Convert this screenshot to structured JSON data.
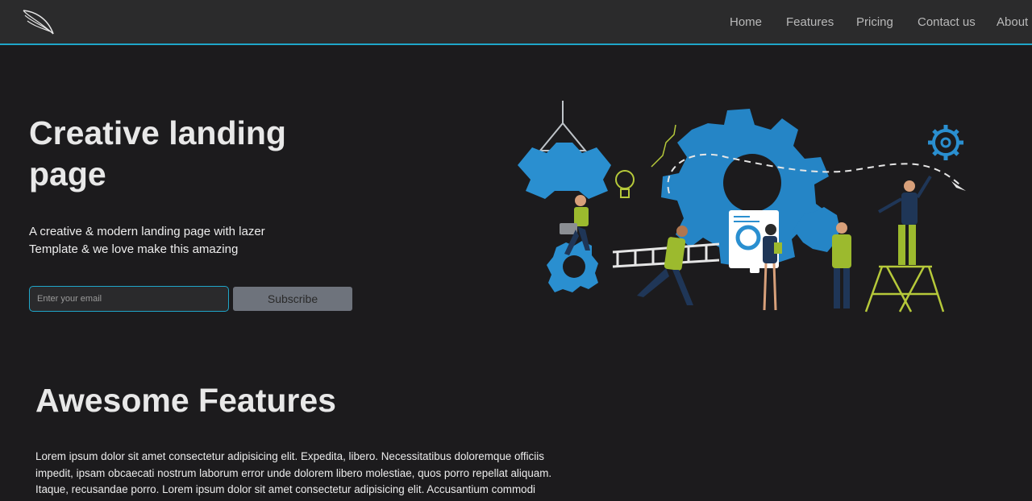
{
  "brand": {
    "logo_icon": "wing-icon"
  },
  "nav": {
    "items": [
      {
        "label": "Home"
      },
      {
        "label": "Features"
      },
      {
        "label": "Pricing"
      },
      {
        "label": "Contact us"
      },
      {
        "label": "About"
      }
    ]
  },
  "hero": {
    "title": "Creative landing page",
    "subtitle": "A creative & modern landing page with lazer Template & we love make this amazing",
    "email_placeholder": "Enter your email",
    "subscribe_label": "Subscribe",
    "illustration": "team-gears-illustration"
  },
  "features": {
    "title": "Awesome Features",
    "text": "Lorem ipsum dolor sit amet consectetur adipisicing elit. Expedita, libero. Necessitatibus doloremque officiis impedit, ipsam obcaecati nostrum laborum error unde dolorem libero molestiae, quos porro repellat aliquam. Itaque, recusandae porro. Lorem ipsum dolor sit amet consectetur adipisicing elit. Accusantium commodi"
  },
  "colors": {
    "background": "#1c1b1d",
    "navbar": "#2b2b2c",
    "accent": "#1fa6c9",
    "gear_blue": "#2a8fd0",
    "figure_green": "#9cba2e",
    "figure_navy": "#1f3657"
  }
}
